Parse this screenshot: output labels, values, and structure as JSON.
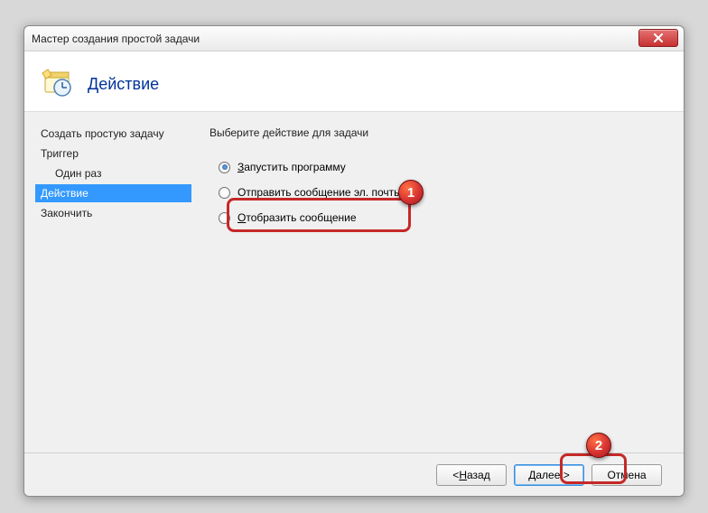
{
  "window": {
    "title": "Мастер создания простой задачи"
  },
  "header": {
    "page_title": "Действие"
  },
  "sidebar": {
    "items": [
      {
        "label": "Создать простую задачу",
        "indent": false,
        "selected": false
      },
      {
        "label": "Триггер",
        "indent": false,
        "selected": false
      },
      {
        "label": "Один раз",
        "indent": true,
        "selected": false
      },
      {
        "label": "Действие",
        "indent": false,
        "selected": true
      },
      {
        "label": "Закончить",
        "indent": false,
        "selected": false
      }
    ]
  },
  "content": {
    "instruction": "Выберите действие для задачи",
    "options": [
      {
        "hotkey": "З",
        "rest": "апустить программу",
        "checked": true
      },
      {
        "hotkey": "",
        "rest": "Отправить сообщение эл. почты",
        "checked": false
      },
      {
        "hotkey": "О",
        "rest": "тобразить сообщение",
        "checked": false
      }
    ]
  },
  "footer": {
    "back": {
      "hotkey": "Н",
      "rest": "азад",
      "prefix": "< "
    },
    "next": {
      "hotkey": "Д",
      "rest": "алее >",
      "prefix": ""
    },
    "cancel": "Отмена"
  },
  "markers": {
    "one": "1",
    "two": "2"
  }
}
